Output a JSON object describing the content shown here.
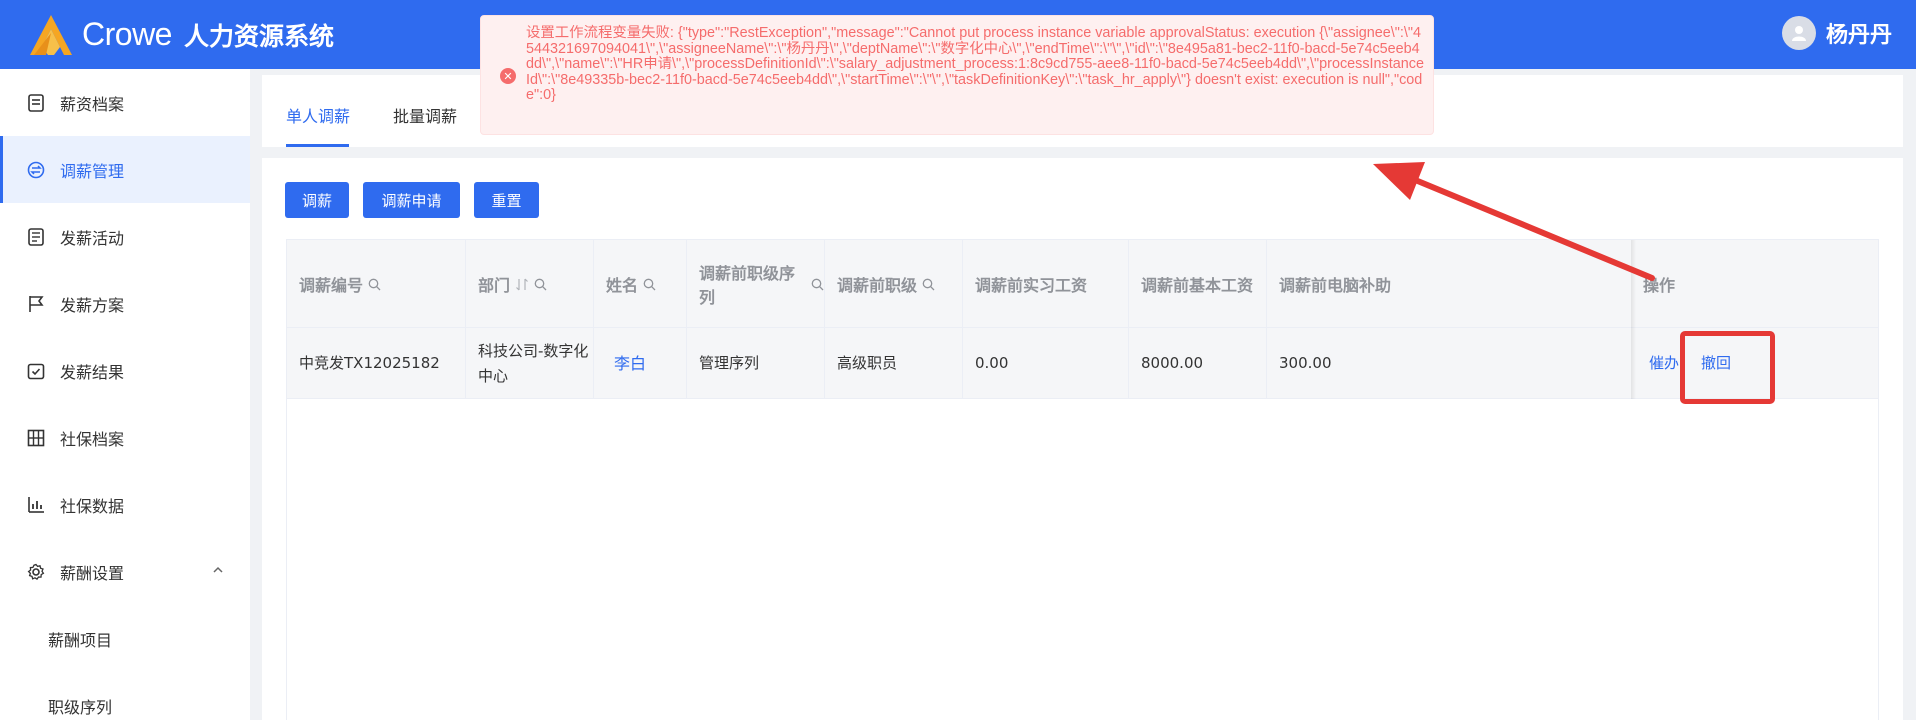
{
  "header": {
    "logo_text": "Crowe",
    "app_title": "人力资源系统",
    "user_name": "杨丹丹"
  },
  "sidebar": {
    "items": [
      {
        "label": "薪资档案",
        "icon": "document-icon"
      },
      {
        "label": "调薪管理",
        "icon": "exchange-icon",
        "active": true
      },
      {
        "label": "发薪活动",
        "icon": "list-icon"
      },
      {
        "label": "发薪方案",
        "icon": "flag-icon"
      },
      {
        "label": "发薪结果",
        "icon": "check-calendar-icon"
      },
      {
        "label": "社保档案",
        "icon": "grid-icon"
      },
      {
        "label": "社保数据",
        "icon": "bar-chart-icon"
      },
      {
        "label": "薪酬设置",
        "icon": "gear-icon",
        "expanded": true
      },
      {
        "label": "薪酬项目",
        "sub": true
      },
      {
        "label": "职级序列",
        "sub": true
      }
    ]
  },
  "tabs": [
    {
      "label": "单人调薪",
      "active": true
    },
    {
      "label": "批量调薪"
    }
  ],
  "toolbar": {
    "adjust_label": "调薪",
    "apply_label": "调薪申请",
    "reset_label": "重置"
  },
  "table": {
    "columns": [
      "调薪编号",
      "部门",
      "姓名",
      "调薪前职级序列",
      "调薪前职级",
      "调薪前实习工资",
      "调薪前基本工资",
      "调薪前电脑补助",
      "操作"
    ],
    "rows": [
      {
        "code": "中竞发TX12025182",
        "dept_line1": "科技公司-数字化",
        "dept_line2": "中心",
        "name": "李白",
        "grade_series": "管理序列",
        "grade": "高级职员",
        "intern_salary": "0.00",
        "base_salary": "8000.00",
        "computer_allowance": "300.00",
        "actions": [
          "催办",
          "撤回"
        ]
      }
    ]
  },
  "toast": {
    "type": "error",
    "message": "设置工作流程变量失败: {\"type\":\"RestException\",\"message\":\"Cannot put process instance variable approvalStatus: execution {\\\"assignee\\\":\\\"4544321697094041\\\",\\\"assigneeName\\\":\\\"杨丹丹\\\",\\\"deptName\\\":\\\"数字化中心\\\",\\\"endTime\\\":\\\"\\\",\\\"id\\\":\\\"8e495a81-bec2-11f0-bacd-5e74c5eeb4dd\\\",\\\"name\\\":\\\"HR申请\\\",\\\"processDefinitionId\\\":\\\"salary_adjustment_process:1:8c9cd755-aee8-11f0-bacd-5e74c5eeb4dd\\\",\\\"processInstanceId\\\":\\\"8e49335b-bec2-11f0-bacd-5e74c5eeb4dd\\\",\\\"startTime\\\":\\\"\\\",\\\"taskDefinitionKey\\\":\\\"task_hr_apply\\\"} doesn't exist: execution is null\",\"code\":0}"
  },
  "colors": {
    "primary": "#2f6bef",
    "error": "#f56c6c",
    "annotation": "#e53935"
  }
}
